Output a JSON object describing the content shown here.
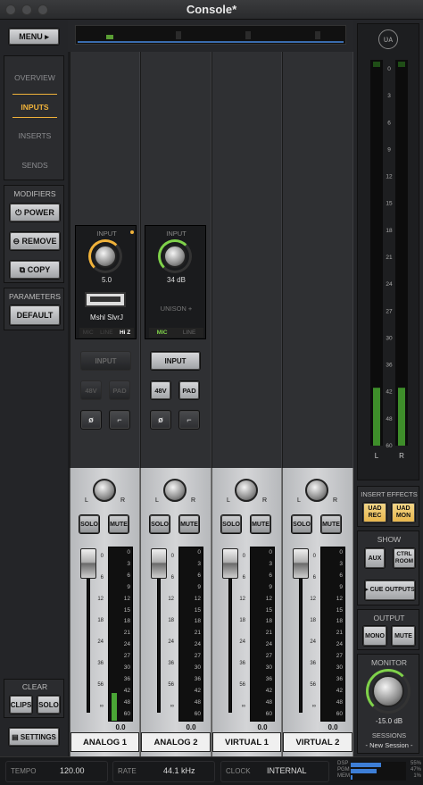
{
  "window": {
    "title": "Console*"
  },
  "left": {
    "menu": "MENU",
    "nav": [
      "OVERVIEW",
      "INPUTS",
      "INSERTS",
      "SENDS"
    ],
    "modifiers_label": "MODIFIERS",
    "power": "POWER",
    "remove": "REMOVE",
    "copy": "COPY",
    "parameters_label": "PARAMETERS",
    "default": "DEFAULT",
    "clear_label": "CLEAR",
    "clips": "CLIPS",
    "solo": "SOLO",
    "settings": "SETTINGS"
  },
  "inputs": [
    {
      "label": "INPUT",
      "value": "5.0",
      "plugin": "Mshl SlvrJ",
      "opts": [
        "MIC",
        "LINE",
        "Hi Z"
      ],
      "active_opt": "Hi Z",
      "input_btn": "INPUT",
      "v48": "48V",
      "pad": "PAD",
      "phase": "ø"
    },
    {
      "label": "INPUT",
      "value": "34 dB",
      "plugin": "UNISON +",
      "opts": [
        "MIC",
        "LINE"
      ],
      "active_opt": "MIC",
      "input_btn": "INPUT",
      "v48": "48V",
      "pad": "PAD",
      "phase": "ø"
    }
  ],
  "channels": [
    {
      "name": "ANALOG 1",
      "value": "0.0",
      "level": 0.16
    },
    {
      "name": "ANALOG 2",
      "value": "0.0",
      "level": 0
    },
    {
      "name": "VIRTUAL 1",
      "value": "0.0",
      "level": 0
    },
    {
      "name": "VIRTUAL 2",
      "value": "0.0",
      "level": 0
    }
  ],
  "strip_labels": {
    "l": "L",
    "r": "R",
    "solo": "SOLO",
    "mute": "MUTE"
  },
  "fader_scale": [
    "0",
    "6",
    "12",
    "18",
    "24",
    "36",
    "56",
    "∞"
  ],
  "meter_scale": [
    "0",
    "3",
    "6",
    "9",
    "12",
    "15",
    "18",
    "21",
    "24",
    "27",
    "30",
    "36",
    "42",
    "48",
    "60"
  ],
  "master_scale": [
    "0",
    "3",
    "6",
    "9",
    "12",
    "15",
    "18",
    "21",
    "24",
    "27",
    "30",
    "36",
    "42",
    "48",
    "60"
  ],
  "master": {
    "l": "L",
    "r": "R",
    "level_l": 0.15,
    "level_r": 0.15
  },
  "right": {
    "insert_effects": "INSERT EFFECTS",
    "uad_rec": "UAD REC",
    "uad_mon": "UAD MON",
    "show": "SHOW",
    "aux": "AUX",
    "ctrl_room": "CTRL ROOM",
    "cue_outputs": "CUE OUTPUTS",
    "output": "OUTPUT",
    "mono": "MONO",
    "mute": "MUTE",
    "monitor": "MONITOR",
    "monitor_value": "-15.0 dB",
    "sessions": "SESSIONS",
    "session_name": "- New Session -"
  },
  "status": {
    "tempo_label": "TEMPO",
    "tempo": "120.00",
    "rate_label": "RATE",
    "rate": "44.1 kHz",
    "clock_label": "CLOCK",
    "clock": "INTERNAL",
    "dsp": "DSP",
    "pgm": "PGM",
    "mem": "MEM",
    "dsp_pct": "55%",
    "pgm_pct": "47%",
    "mem_pct": "1%"
  },
  "colors": {
    "accent": "#f0b23a",
    "green": "#7fd14a",
    "meter_green": "#3e8e2a"
  }
}
